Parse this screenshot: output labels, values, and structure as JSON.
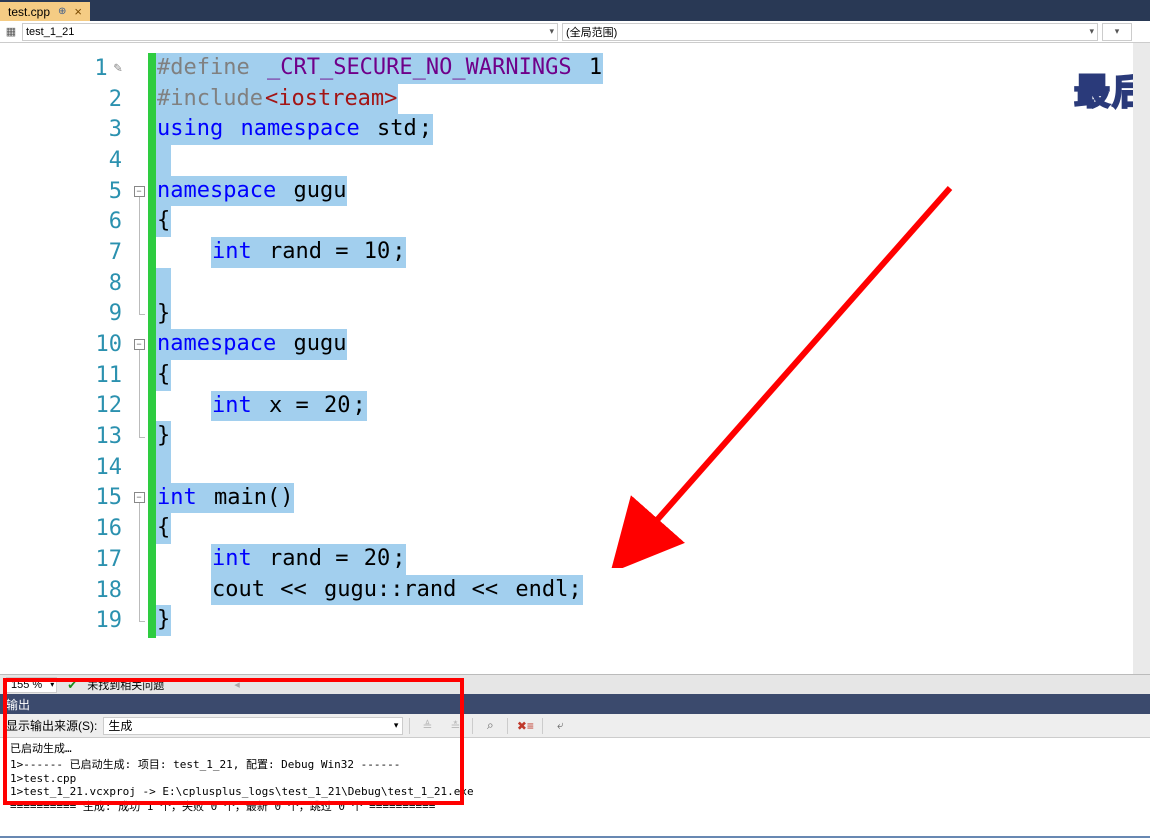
{
  "tab": {
    "name": "test.cpp",
    "pinnable": true
  },
  "nav": {
    "file": "test_1_21",
    "scope": "(全局范围)"
  },
  "zoom": "155 %",
  "status_msg": "未找到相关问题",
  "watermark": "最后",
  "code": {
    "lines": [
      {
        "n": 1,
        "pencil": true,
        "fold": "",
        "tokens": [
          {
            "c": "dir hl",
            "t": "#define"
          },
          {
            "c": "hl",
            "t": " "
          },
          {
            "c": "macro hl",
            "t": "_CRT_SECURE_NO_WARNINGS"
          },
          {
            "c": "hl",
            "t": " "
          },
          {
            "c": "num hl",
            "t": "1"
          }
        ]
      },
      {
        "n": 2,
        "tokens": [
          {
            "c": "dir hl",
            "t": "#include"
          },
          {
            "c": "inc hl",
            "t": "<iostream>"
          }
        ]
      },
      {
        "n": 3,
        "tokens": [
          {
            "c": "kw hl",
            "t": "using"
          },
          {
            "c": "hl",
            "t": " "
          },
          {
            "c": "kw hl",
            "t": "namespace"
          },
          {
            "c": "hl",
            "t": " "
          },
          {
            "c": "ns hl",
            "t": "std"
          },
          {
            "c": "txt hl",
            "t": ";"
          }
        ]
      },
      {
        "n": 4,
        "tokens": [
          {
            "c": "hl",
            "t": " "
          }
        ]
      },
      {
        "n": 5,
        "fold": "-",
        "tokens": [
          {
            "c": "kw hl",
            "t": "namespace"
          },
          {
            "c": "hl",
            "t": " "
          },
          {
            "c": "ns hl",
            "t": "gugu"
          }
        ]
      },
      {
        "n": 6,
        "fold": "|",
        "tokens": [
          {
            "c": "txt hl",
            "t": "{"
          }
        ]
      },
      {
        "n": 7,
        "fold": "|",
        "tokens": [
          {
            "c": "txt",
            "t": "    "
          },
          {
            "c": "kw hl",
            "t": "int"
          },
          {
            "c": "hl",
            "t": " "
          },
          {
            "c": "txt hl",
            "t": "rand = "
          },
          {
            "c": "num hl",
            "t": "10"
          },
          {
            "c": "txt hl",
            "t": ";"
          }
        ]
      },
      {
        "n": 8,
        "fold": "|",
        "tokens": [
          {
            "c": "hl",
            "t": " "
          }
        ]
      },
      {
        "n": 9,
        "fold": "L",
        "tokens": [
          {
            "c": "txt hl",
            "t": "}"
          }
        ]
      },
      {
        "n": 10,
        "fold": "-",
        "tokens": [
          {
            "c": "kw hl",
            "t": "namespace"
          },
          {
            "c": "hl",
            "t": " "
          },
          {
            "c": "ns hl",
            "t": "gugu"
          }
        ]
      },
      {
        "n": 11,
        "fold": "|",
        "tokens": [
          {
            "c": "txt hl",
            "t": "{"
          }
        ]
      },
      {
        "n": 12,
        "fold": "|",
        "tokens": [
          {
            "c": "txt",
            "t": "    "
          },
          {
            "c": "kw hl",
            "t": "int"
          },
          {
            "c": "hl",
            "t": " "
          },
          {
            "c": "txt hl",
            "t": "x = "
          },
          {
            "c": "num hl",
            "t": "20"
          },
          {
            "c": "txt hl",
            "t": ";"
          }
        ]
      },
      {
        "n": 13,
        "fold": "L",
        "tokens": [
          {
            "c": "txt hl",
            "t": "}"
          }
        ]
      },
      {
        "n": 14,
        "tokens": [
          {
            "c": "hl",
            "t": " "
          }
        ]
      },
      {
        "n": 15,
        "fold": "-",
        "tokens": [
          {
            "c": "kw hl",
            "t": "int"
          },
          {
            "c": "hl",
            "t": " "
          },
          {
            "c": "txt hl",
            "t": "main()"
          }
        ]
      },
      {
        "n": 16,
        "fold": "|",
        "tokens": [
          {
            "c": "txt hl",
            "t": "{"
          }
        ]
      },
      {
        "n": 17,
        "fold": "|",
        "tokens": [
          {
            "c": "txt",
            "t": "    "
          },
          {
            "c": "kw hl",
            "t": "int"
          },
          {
            "c": "hl",
            "t": " "
          },
          {
            "c": "txt hl",
            "t": "rand = "
          },
          {
            "c": "num hl",
            "t": "20"
          },
          {
            "c": "txt hl",
            "t": ";"
          }
        ]
      },
      {
        "n": 18,
        "fold": "|",
        "tokens": [
          {
            "c": "txt",
            "t": "    "
          },
          {
            "c": "txt hl",
            "t": "cout "
          },
          {
            "c": "op hl",
            "t": "<<"
          },
          {
            "c": "hl",
            "t": " "
          },
          {
            "c": "txt hl",
            "t": "gugu::rand "
          },
          {
            "c": "op hl",
            "t": "<<"
          },
          {
            "c": "hl",
            "t": " "
          },
          {
            "c": "txt hl",
            "t": "endl;"
          }
        ]
      },
      {
        "n": 19,
        "fold": "L",
        "tokens": [
          {
            "c": "txt hl",
            "t": "}"
          }
        ]
      }
    ]
  },
  "output": {
    "title": "输出",
    "source_label": "显示输出来源(S):",
    "source_value": "生成",
    "lines": [
      "已启动生成…",
      "1>------ 已启动生成: 项目: test_1_21, 配置: Debug Win32 ------",
      "1>test.cpp",
      "1>test_1_21.vcxproj -> E:\\cplusplus_logs\\test_1_21\\Debug\\test_1_21.exe",
      "========== 生成: 成功 1 个，失败 0 个，最新 0 个，跳过 0 个 =========="
    ]
  }
}
